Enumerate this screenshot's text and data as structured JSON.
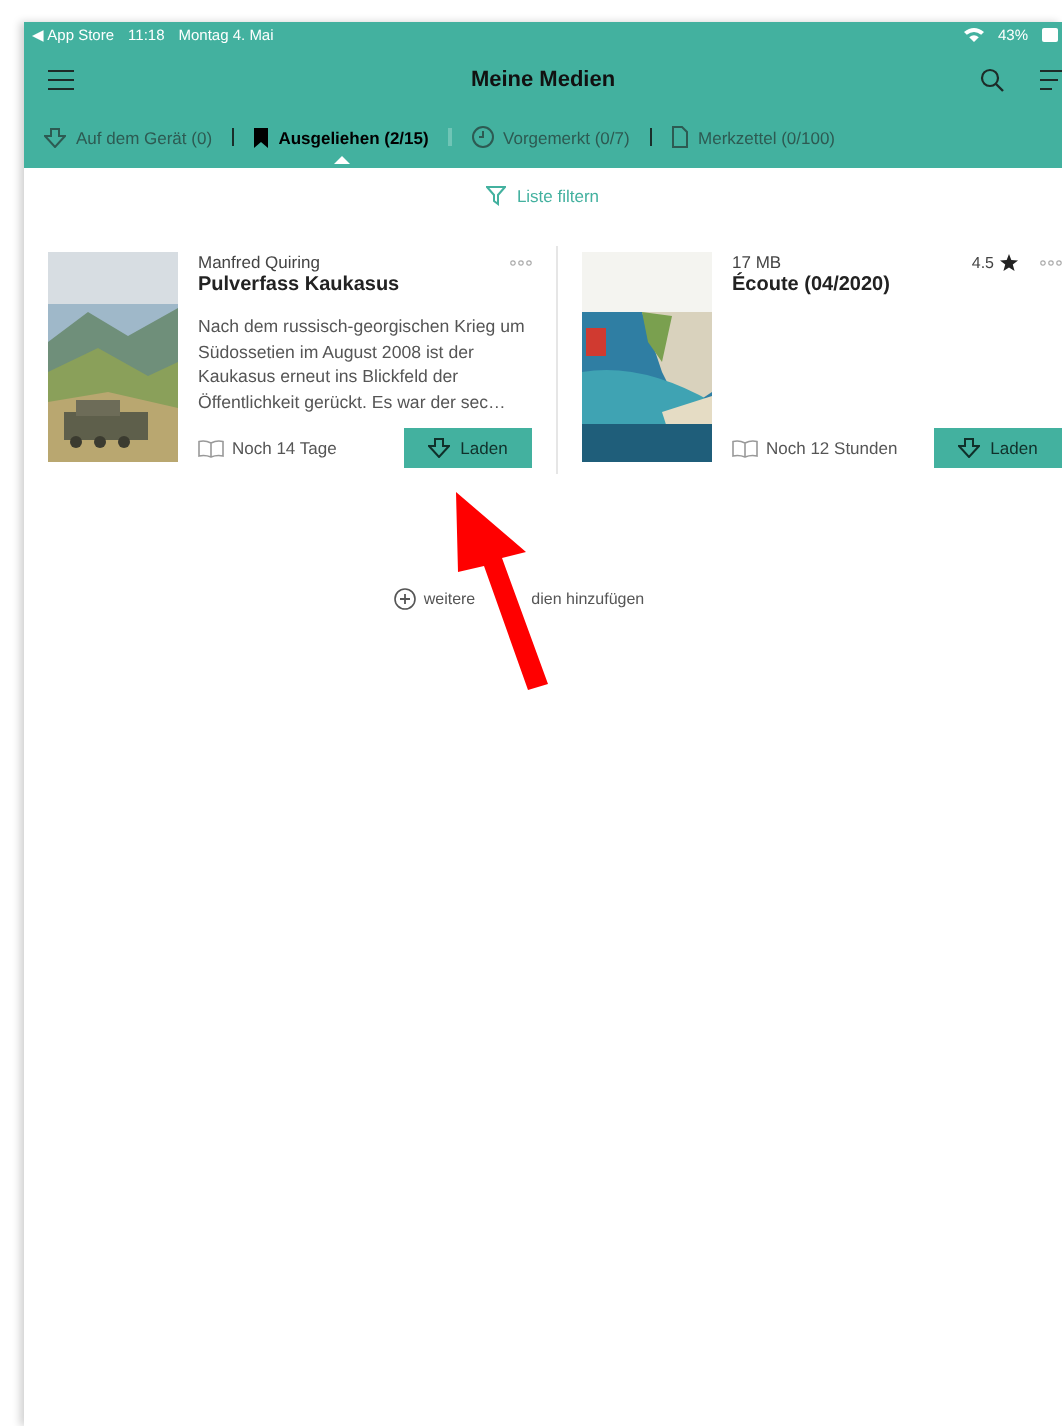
{
  "status_bar": {
    "back_label": "◀ App Store",
    "time": "11:18",
    "date": "Montag 4. Mai",
    "battery": "43%"
  },
  "header": {
    "title": "Meine Medien"
  },
  "tabs": [
    {
      "label": "Auf dem Gerät (0)",
      "kind": "download",
      "selected": false
    },
    {
      "label": "Ausgeliehen (2/15)",
      "kind": "bookmark",
      "selected": true
    },
    {
      "label": "Vorgemerkt (0/7)",
      "kind": "clock",
      "selected": false
    },
    {
      "label": "Merkzettel (0/100)",
      "kind": "document",
      "selected": false
    }
  ],
  "filter": {
    "label": "Liste filtern"
  },
  "media": [
    {
      "meta": "Manfred Quiring",
      "title": "Pulverfass Kaukasus",
      "description": "Nach dem russisch-georgischen Krieg um Südossetien im August 2008 ist der Kaukasus erneut ins Blickfeld der Öffentlichkeit gerückt. Es war der sec…",
      "remaining": "Noch 14 Tage",
      "button": "Laden",
      "kind": "book"
    },
    {
      "meta": "17 MB",
      "title": "Écoute (04/2020)",
      "rating": "4.5",
      "remaining": "Noch 12 Stunden",
      "button": "Laden",
      "kind": "magazine"
    }
  ],
  "add_media": {
    "visible_parts": [
      "weitere",
      "dien hinzufügen"
    ]
  }
}
